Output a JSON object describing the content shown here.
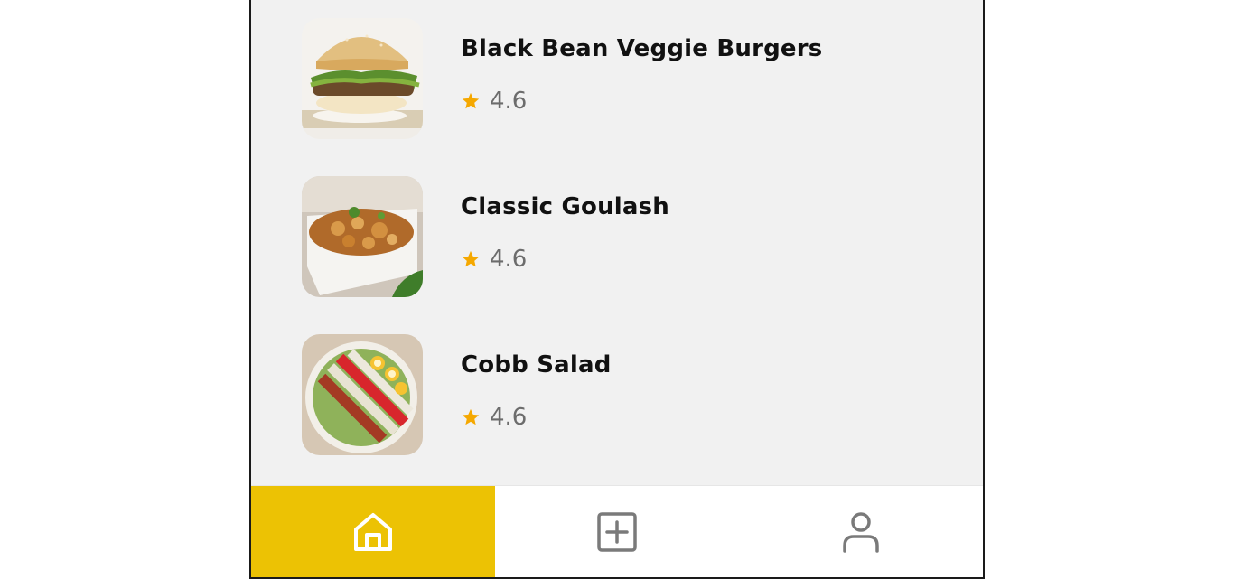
{
  "recipes": [
    {
      "title": "Black Bean Veggie Burgers",
      "rating": "4.6",
      "image_icon": "burger-photo"
    },
    {
      "title": "Classic Goulash",
      "rating": "4.6",
      "image_icon": "goulash-photo"
    },
    {
      "title": "Cobb Salad",
      "rating": "4.6",
      "image_icon": "cobb-salad-photo"
    }
  ],
  "nav": {
    "items": [
      {
        "icon": "home-icon",
        "active": true
      },
      {
        "icon": "add-icon",
        "active": false
      },
      {
        "icon": "profile-icon",
        "active": false
      }
    ]
  },
  "colors": {
    "accent": "#ecc204",
    "star": "#f5a800",
    "background": "#f1f1f1",
    "title_text": "#111111",
    "rating_text": "#6c6c6c",
    "nav_icon_active": "#ffffff",
    "nav_icon_inactive": "#7a7a7a"
  }
}
